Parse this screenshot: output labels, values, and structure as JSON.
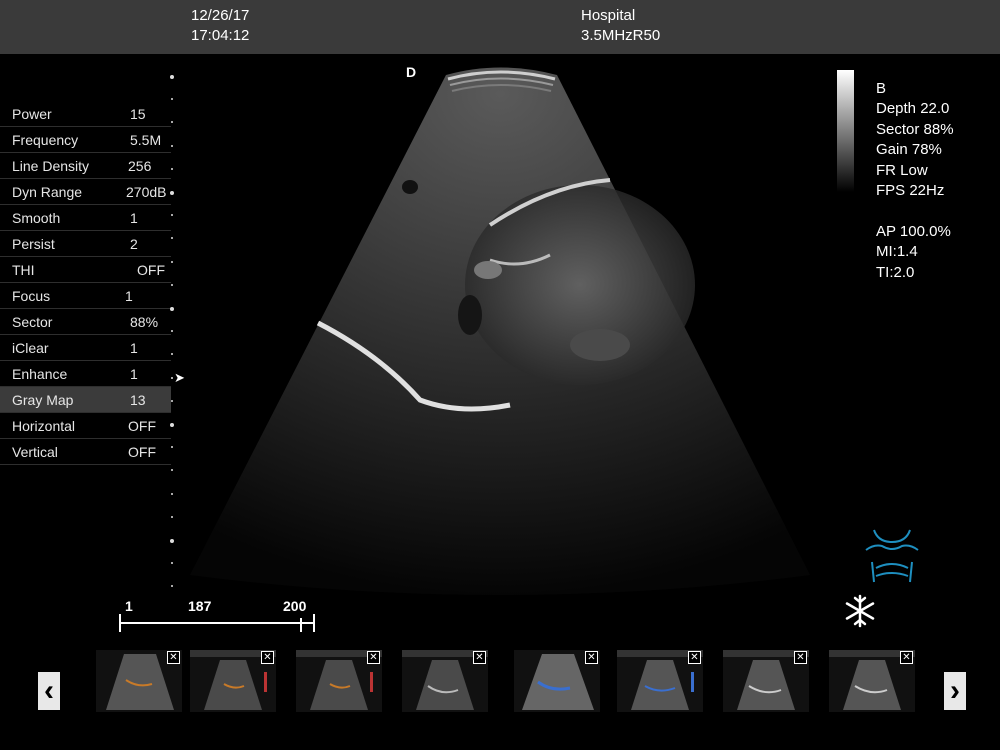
{
  "header": {
    "date": "12/26/17",
    "time": "17:04:12",
    "institution": "Hospital",
    "probe": "3.5MHzR50"
  },
  "params": [
    {
      "label": "Power",
      "value": "15"
    },
    {
      "label": "Frequency",
      "value": "5.5M"
    },
    {
      "label": "Line Density",
      "value": "256"
    },
    {
      "label": "Dyn Range",
      "value": "270dB"
    },
    {
      "label": "Smooth",
      "value": "1"
    },
    {
      "label": "Persist",
      "value": "2"
    },
    {
      "label": "THI",
      "value": "OFF"
    },
    {
      "label": "Focus",
      "value": "1"
    },
    {
      "label": "Sector",
      "value": "88%"
    },
    {
      "label": "iClear",
      "value": "1"
    },
    {
      "label": "Enhance",
      "value": "1"
    },
    {
      "label": "Gray Map",
      "value": "13",
      "selected": true
    },
    {
      "label": "Horizontal",
      "value": "OFF"
    },
    {
      "label": "Vertical",
      "value": "OFF"
    }
  ],
  "orientation_marker": "D",
  "image_info": {
    "mode": "B",
    "depth": "Depth 22.0",
    "sector": "Sector 88%",
    "gain": "Gain 78%",
    "fr": "FR Low",
    "fps": "FPS 22Hz",
    "ap": "AP 100.0%",
    "mi": "MI:1.4",
    "ti": "TI:2.0"
  },
  "cine": {
    "start": "1",
    "current": "187",
    "end": "200"
  },
  "thumbnails": [
    {
      "close": "✕"
    },
    {
      "close": "✕"
    },
    {
      "close": "✕"
    },
    {
      "close": "✕"
    },
    {
      "close": "✕"
    },
    {
      "close": "✕"
    },
    {
      "close": "✕"
    },
    {
      "close": "✕"
    }
  ],
  "icons": {
    "body_mark": "torso-bodymark-icon",
    "freeze": "snowflake-freeze-icon",
    "prev": "chevron-left-icon",
    "next": "chevron-right-icon"
  },
  "colors": {
    "body_mark": "#1e8fc0",
    "top_bar": "#3a3a3a"
  }
}
